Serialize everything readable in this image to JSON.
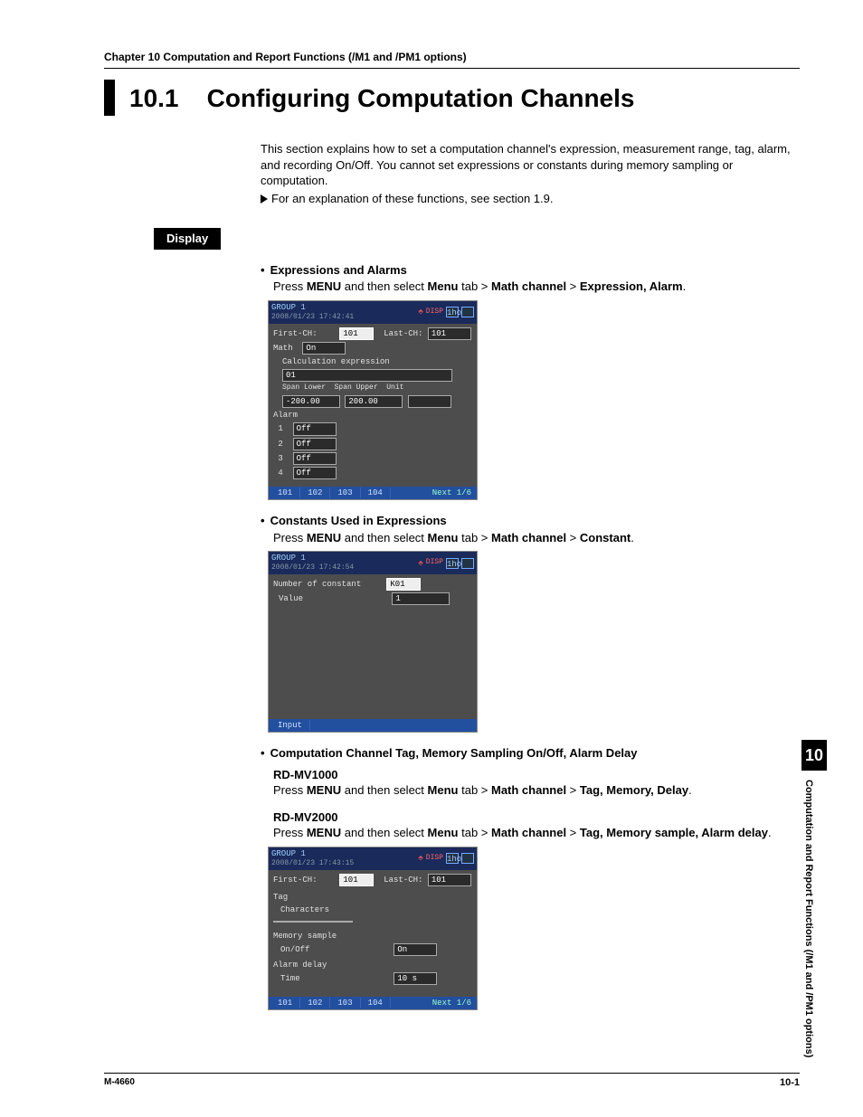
{
  "chapter_header": "Chapter 10   Computation and Report Functions (/M1 and /PM1 options)",
  "section_number": "10.1",
  "section_title": "Configuring Computation Channels",
  "intro": {
    "p1": "This section explains how to set a computation channel's expression, measurement range, tag, alarm, and recording On/Off. You cannot set expressions or constants during memory sampling or computation.",
    "p2": "For an explanation of these functions, see section 1.9."
  },
  "display_label": "Display",
  "items": [
    {
      "title": "Expressions and Alarms",
      "press_prefix": "Press ",
      "press_menu": "MENU",
      "press_mid": " and then select ",
      "press_path": [
        "Menu",
        " tab > ",
        "Math channel",
        " > ",
        "Expression, Alarm",
        "."
      ],
      "screen": {
        "group": "GROUP 1",
        "timestamp": "2008/01/23 17:42:41",
        "fields": {
          "first_ch_label": "First-CH:",
          "first_ch_value": "101",
          "last_ch_label": "Last-CH:",
          "last_ch_value": "101",
          "math_label": "Math",
          "math_value": "On",
          "calc_label": "Calculation expression",
          "calc_value": "01",
          "span_lower_label": "Span Lower",
          "span_lower_value": "-200.00",
          "span_upper_label": "Span Upper",
          "span_upper_value": "200.00",
          "unit_label": "Unit",
          "alarm_label": "Alarm",
          "alarm_values": [
            "Off",
            "Off",
            "Off",
            "Off"
          ]
        },
        "footer_tabs": [
          "101",
          "102",
          "103",
          "104"
        ],
        "footer_next": "Next 1/6",
        "status_bar": "1hour"
      }
    },
    {
      "title": "Constants Used in Expressions",
      "press_prefix": "Press ",
      "press_menu": "MENU",
      "press_mid": " and then select ",
      "press_path": [
        "Menu",
        " tab > ",
        "Math channel",
        " > ",
        "Constant",
        "."
      ],
      "screen": {
        "group": "GROUP 1",
        "timestamp": "2008/01/23 17:42:54",
        "fields": {
          "num_label": "Number of constant",
          "num_value": "K01",
          "value_label": "Value",
          "value_value": "1"
        },
        "footer_tabs": [
          "Input"
        ],
        "status_bar": "1hour"
      }
    },
    {
      "title": "Computation Channel Tag, Memory Sampling On/Off, Alarm Delay",
      "model1_label": "RD-MV1000",
      "model1_press_prefix": "Press ",
      "model1_press_menu": "MENU",
      "model1_press_mid": " and then select ",
      "model1_press_path": [
        "Menu",
        " tab > ",
        "Math channel",
        " > ",
        "Tag, Memory, Delay",
        "."
      ],
      "model2_label": "RD-MV2000",
      "model2_press_prefix": "Press ",
      "model2_press_menu": "MENU",
      "model2_press_mid": " and then select ",
      "model2_press_path": [
        "Menu",
        " tab > ",
        "Math channel",
        " > ",
        "Tag, Memory sample, Alarm delay",
        "."
      ],
      "screen": {
        "group": "GROUP 1",
        "timestamp": "2008/01/23 17:43:15",
        "fields": {
          "first_ch_label": "First-CH:",
          "first_ch_value": "101",
          "last_ch_label": "Last-CH:",
          "last_ch_value": "101",
          "tag_label": "Tag",
          "characters_label": "Characters",
          "characters_value": "",
          "mem_label": "Memory sample",
          "onoff_label": "On/Off",
          "onoff_value": "On",
          "adelay_label": "Alarm delay",
          "time_label": "Time",
          "time_value": "10 s"
        },
        "footer_tabs": [
          "101",
          "102",
          "103",
          "104"
        ],
        "footer_next": "Next 1/6",
        "status_bar": "1hour"
      }
    }
  ],
  "side_tab": {
    "number": "10",
    "label": "Computation and Report Functions (/M1 and /PM1 options)"
  },
  "footer": {
    "doc": "M-4660",
    "page": "10-1"
  }
}
